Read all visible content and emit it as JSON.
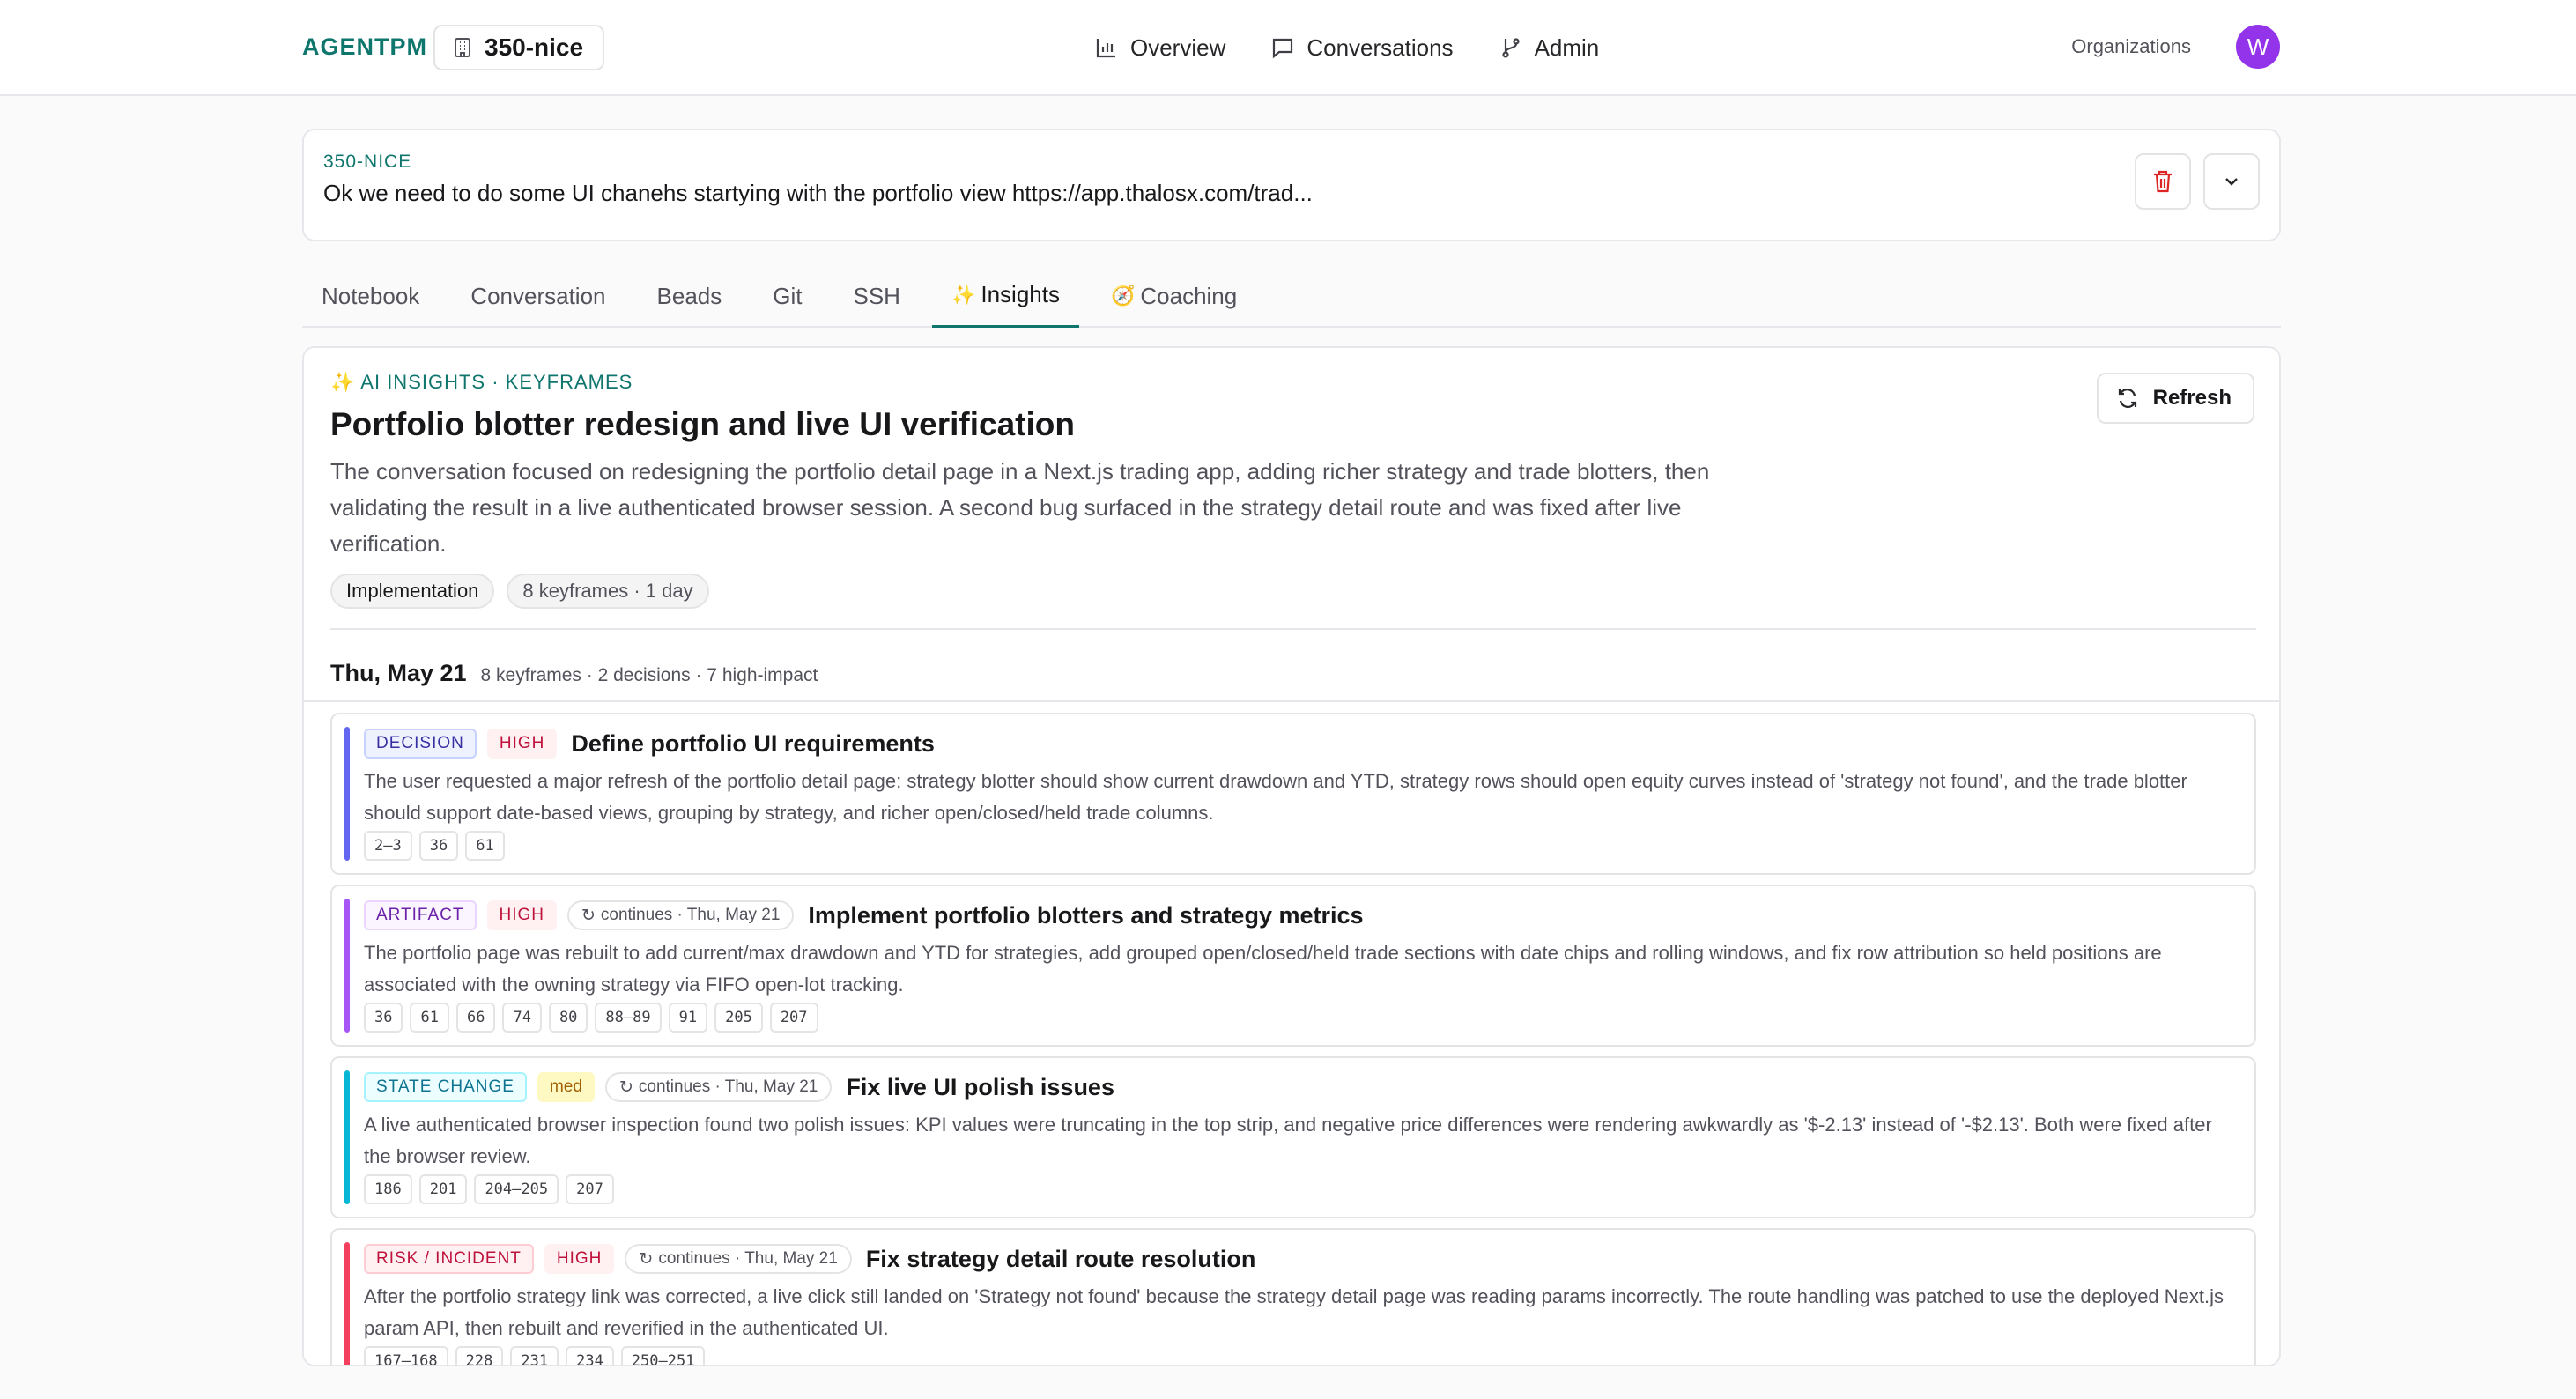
{
  "brand": "AGENTPM",
  "project": {
    "name": "350-nice",
    "icon": "building-icon"
  },
  "nav": [
    {
      "label": "Overview",
      "icon": "bar-chart-icon"
    },
    {
      "label": "Conversations",
      "icon": "message-square-icon"
    },
    {
      "label": "Admin",
      "icon": "git-branch-icon"
    }
  ],
  "organizations_label": "Organizations",
  "user": {
    "initial": "W",
    "avatar_color": "#9333ea"
  },
  "header": {
    "slug": "350-NICE",
    "prompt": "Ok we need to do some UI chanehs startying with the portfolio view https://app.thalosx.com/trad..."
  },
  "tabs": [
    {
      "label": "Notebook",
      "prefix": ""
    },
    {
      "label": "Conversation",
      "prefix": ""
    },
    {
      "label": "Beads",
      "prefix": ""
    },
    {
      "label": "Git",
      "prefix": ""
    },
    {
      "label": "SSH",
      "prefix": ""
    },
    {
      "label": "Insights",
      "prefix": "✨",
      "active": true
    },
    {
      "label": "Coaching",
      "prefix": "🧭"
    }
  ],
  "insights": {
    "kicker": "✨ AI INSIGHTS · KEYFRAMES",
    "refresh_label": "Refresh",
    "title": "Portfolio blotter redesign and live UI verification",
    "summary": "The conversation focused on redesigning the portfolio detail page in a Next.js trading app, adding richer strategy and trade blotters, then validating the result in a live authenticated browser session. A second bug surfaced in the strategy detail route and was fixed after live verification.",
    "pills": [
      "Implementation",
      "8 keyframes · 1 day"
    ],
    "day": {
      "label": "Thu, May 21",
      "meta": "8 keyframes · 2 decisions · 7 high-impact"
    }
  },
  "entries": [
    {
      "type": "DECISION",
      "type_class": "decision",
      "impact": "HIGH",
      "impact_class": "high",
      "continues": "",
      "title": "Define portfolio UI requirements",
      "desc": "The user requested a major refresh of the portfolio detail page: strategy blotter should show current drawdown and YTD, strategy rows should open equity curves instead of 'strategy not found', and the trade blotter should support date-based views, grouping by strategy, and richer open/closed/held trade columns.",
      "refs": [
        "2–3",
        "36",
        "61"
      ],
      "bar_color": "#6366f1"
    },
    {
      "type": "ARTIFACT",
      "type_class": "artifact",
      "impact": "HIGH",
      "impact_class": "high",
      "continues": "continues · Thu, May 21",
      "title": "Implement portfolio blotters and strategy metrics",
      "desc": "The portfolio page was rebuilt to add current/max drawdown and YTD for strategies, add grouped open/closed/held trade sections with date chips and rolling windows, and fix row attribution so held positions are associated with the owning strategy via FIFO open-lot tracking.",
      "refs": [
        "36",
        "61",
        "66",
        "74",
        "80",
        "88–89",
        "91",
        "205",
        "207"
      ],
      "bar_color": "#a855f7"
    },
    {
      "type": "STATE CHANGE",
      "type_class": "state",
      "impact": "med",
      "impact_class": "med",
      "continues": "continues · Thu, May 21",
      "title": "Fix live UI polish issues",
      "desc": "A live authenticated browser inspection found two polish issues: KPI values were truncating in the top strip, and negative price differences were rendering awkwardly as '$-2.13' instead of '-$2.13'. Both were fixed after the browser review.",
      "refs": [
        "186",
        "201",
        "204–205",
        "207"
      ],
      "bar_color": "#06b6d4"
    },
    {
      "type": "RISK / INCIDENT",
      "type_class": "risk",
      "impact": "HIGH",
      "impact_class": "high",
      "continues": "continues · Thu, May 21",
      "title": "Fix strategy detail route resolution",
      "desc": "After the portfolio strategy link was corrected, a live click still landed on 'Strategy not found' because the strategy detail page was reading params incorrectly. The route handling was patched to use the deployed Next.js param API, then rebuilt and reverified in the authenticated UI.",
      "refs": [
        "167–168",
        "228",
        "231",
        "234",
        "250–251"
      ],
      "bar_color": "#f43f5e"
    }
  ]
}
